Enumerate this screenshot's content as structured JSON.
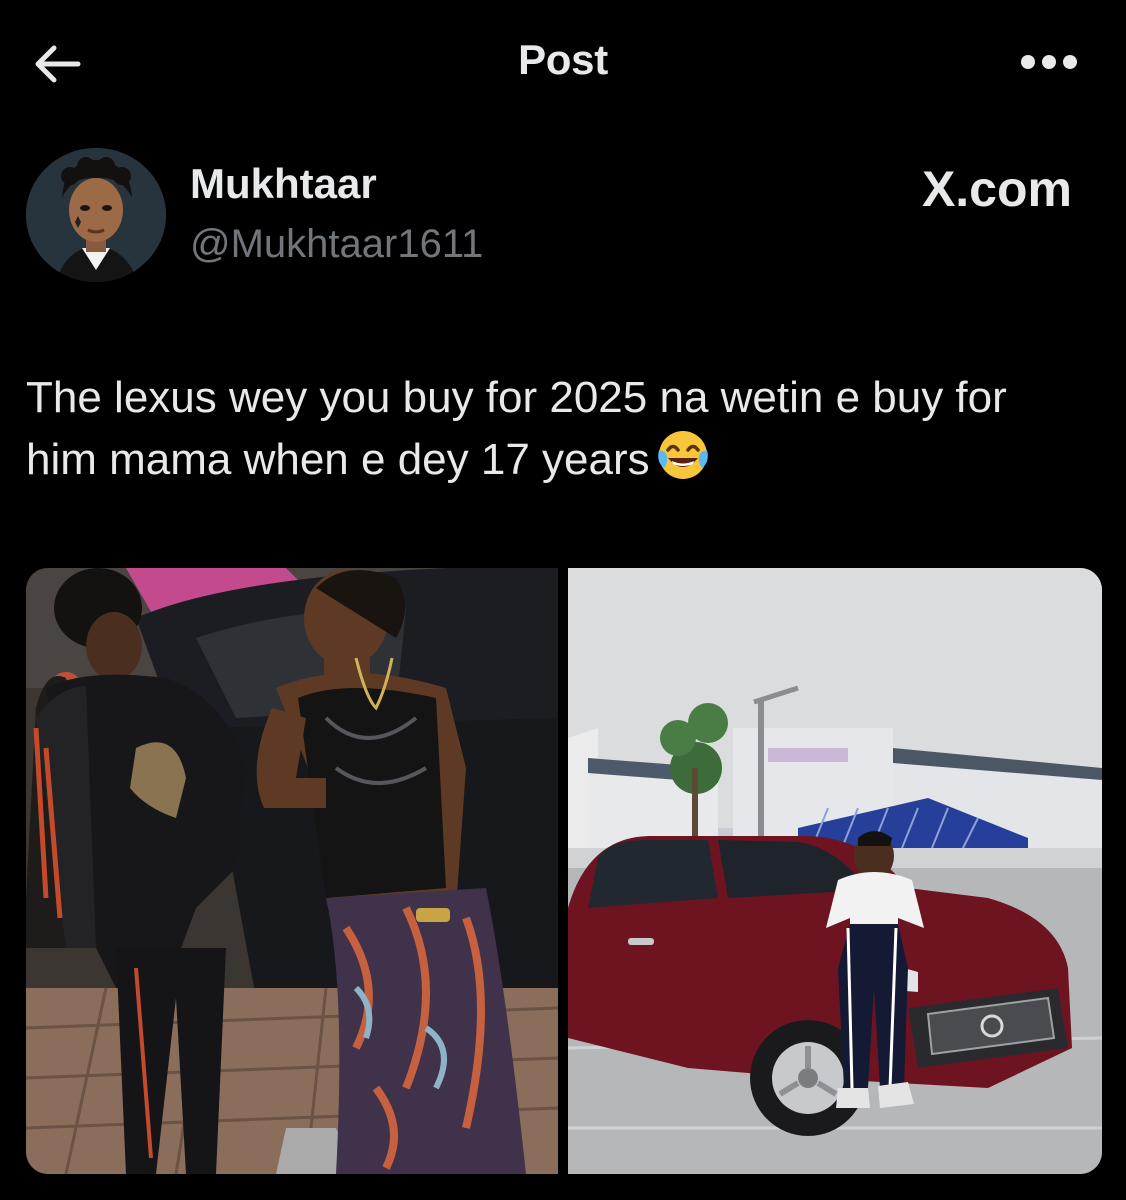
{
  "header": {
    "title": "Post",
    "back_icon": "arrow-left-icon",
    "more_icon": "more-horizontal-icon"
  },
  "author": {
    "display_name": "Mukhtaar",
    "handle": "@Mukhtaar1611",
    "avatar_icon": "avatar-illustration"
  },
  "brand": "X.com",
  "post": {
    "text": "The lexus wey you buy for 2025 na wetin e buy for him mama when e dey 17 years",
    "emoji_icon": "face-with-tears-of-joy-icon"
  },
  "media": [
    {
      "name": "photo-woman-and-young-man-by-car"
    },
    {
      "name": "photo-man-sitting-on-red-lexus"
    }
  ],
  "colors": {
    "background": "#000000",
    "text_primary": "#e7e9ea",
    "text_secondary": "#71767b",
    "car_red": "#6e1420"
  }
}
